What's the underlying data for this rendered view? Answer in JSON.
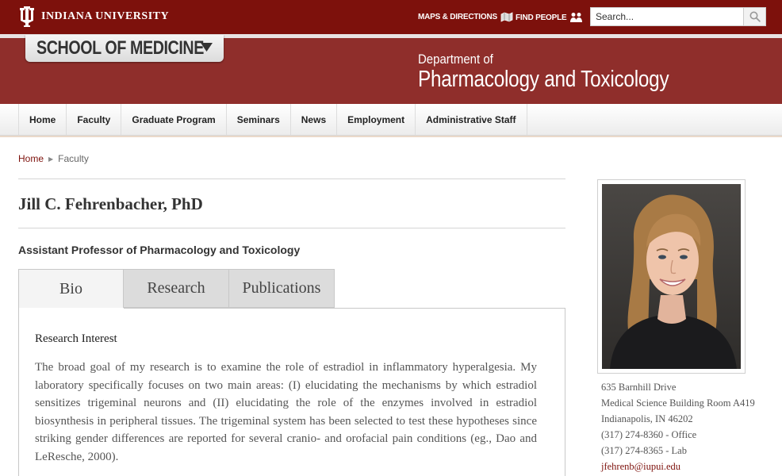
{
  "header": {
    "university": "INDIANA UNIVERSITY",
    "links": [
      {
        "label": "MAPS & DIRECTIONS",
        "icon": "map-icon"
      },
      {
        "label": "FIND PEOPLE",
        "icon": "people-icon"
      }
    ],
    "search": {
      "placeholder": "Search..."
    }
  },
  "banner": {
    "school": "SCHOOL OF MEDICINE",
    "department_sub": "Department of",
    "department_title": "Pharmacology and Toxicology"
  },
  "nav": {
    "items": [
      "Home",
      "Faculty",
      "Graduate Program",
      "Seminars",
      "News",
      "Employment",
      "Administrative Staff"
    ]
  },
  "breadcrumb": {
    "home": "Home",
    "current": "Faculty"
  },
  "profile": {
    "name": "Jill C. Fehrenbacher, PhD",
    "title": "Assistant Professor of Pharmacology and Toxicology",
    "tabs": [
      "Bio",
      "Research",
      "Publications"
    ],
    "active_tab": "Bio",
    "section_heading": "Research Interest",
    "bio_text": "The broad goal of my research is to examine the role of estradiol in inflammatory hyperalgesia. My laboratory specifically focuses on two main areas: (I) elucidating the mechanisms by which estradiol sensitizes trigeminal neurons and (II) elucidating the role of the enzymes involved in estradiol biosynthesis in peripheral tissues. The trigeminal system has been selected to test these hypotheses since striking gender differences are reported for several cranio- and orofacial pain conditions (eg., Dao and LeResche, 2000)."
  },
  "contact": {
    "address1": "635 Barnhill Drive",
    "address2": "Medical Science Building Room A419",
    "city": "Indianapolis, IN 46202",
    "phone_office": "(317) 274-8360 - Office",
    "phone_lab": "(317) 274-8365 - Lab",
    "email": "jfehrenb@iupui.edu"
  },
  "colors": {
    "crimson": "#7d110c",
    "banner": "#8f2e2b"
  }
}
